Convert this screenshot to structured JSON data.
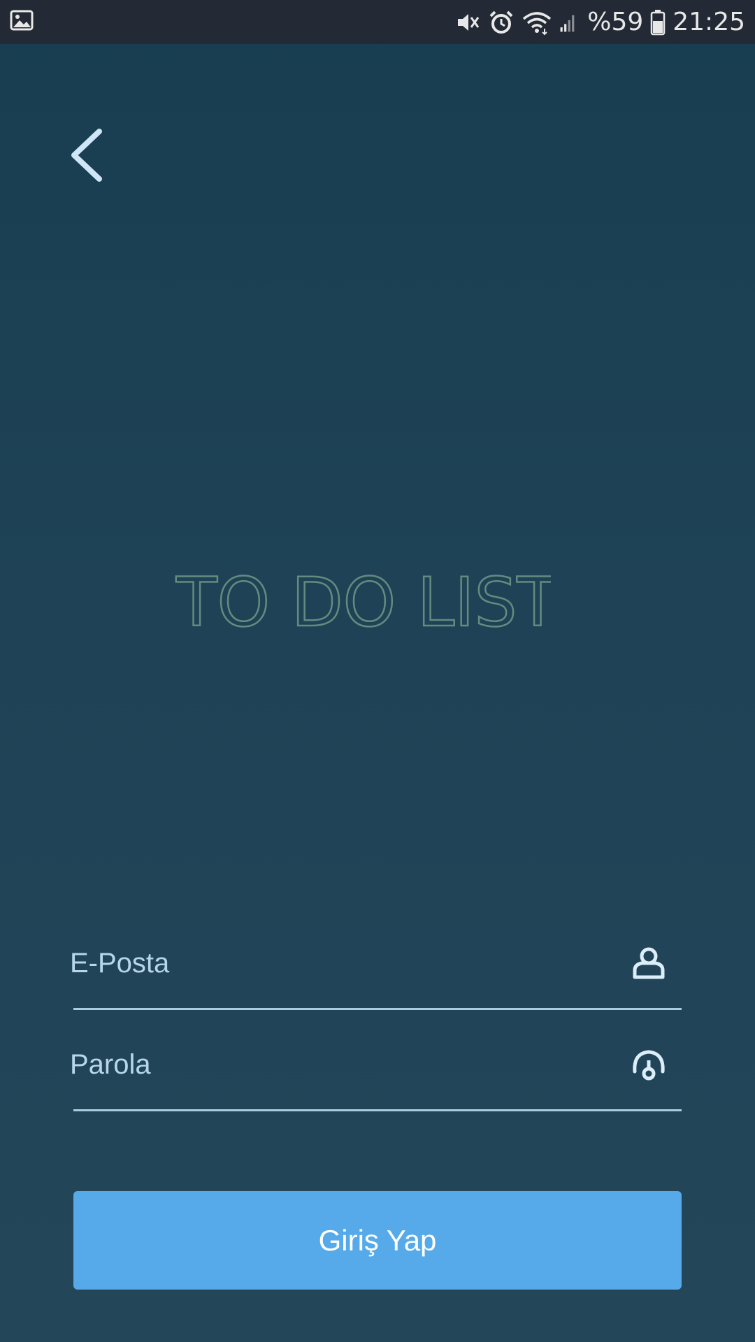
{
  "status_bar": {
    "battery_text": "%59",
    "time": "21:25",
    "icons": [
      "gallery-icon",
      "mute-icon",
      "alarm-icon",
      "wifi-icon",
      "signal-icon",
      "battery-icon"
    ]
  },
  "logo": {
    "text": "TO DO LIST",
    "color": "#6e9a86"
  },
  "form": {
    "email_placeholder": "E-Posta",
    "email_icon": "user-icon",
    "password_placeholder": "Parola",
    "password_icon": "lock-icon",
    "submit_label": "Giriş Yap"
  },
  "colors": {
    "accent": "#56aaea",
    "background_top": "#183d51",
    "background_bottom": "#244659",
    "field_text": "#b7d6ea",
    "status_bar": "#242a35"
  }
}
